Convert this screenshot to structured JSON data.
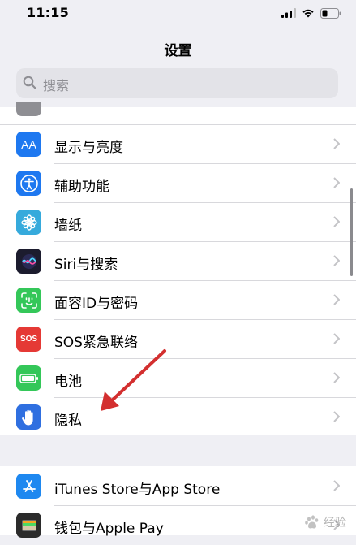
{
  "status_bar": {
    "time": "11:15"
  },
  "title": "设置",
  "search": {
    "placeholder": "搜索"
  },
  "settings_group_1": [
    {
      "label": "显示与亮度",
      "icon": "display-brightness-icon",
      "color": "#1e78f0"
    },
    {
      "label": "辅助功能",
      "icon": "accessibility-icon",
      "color": "#1e78f0"
    },
    {
      "label": "墙纸",
      "icon": "wallpaper-flower-icon",
      "color": "#36aadc"
    },
    {
      "label": "Siri与搜索",
      "icon": "siri-icon",
      "color": "#1c1c2e"
    },
    {
      "label": "面容ID与密码",
      "icon": "face-id-icon",
      "color": "#34c759"
    },
    {
      "label": "SOS紧急联络",
      "icon": "sos-icon",
      "color": "#e53935"
    },
    {
      "label": "电池",
      "icon": "battery-icon",
      "color": "#34c759"
    },
    {
      "label": "隐私",
      "icon": "privacy-hand-icon",
      "color": "#2f6fe0"
    }
  ],
  "settings_group_2": [
    {
      "label": "iTunes Store与App Store",
      "icon": "app-store-icon",
      "color": "#1e88f0"
    },
    {
      "label": "钱包与Apple Pay",
      "icon": "wallet-icon",
      "color": "#2b2b2b"
    }
  ],
  "watermark": {
    "text": "经验"
  }
}
